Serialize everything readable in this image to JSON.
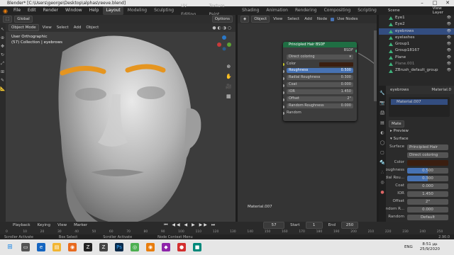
{
  "window": {
    "title": "Blender* [C:\\Users\\george\\Desktop\\alphas\\reeve.blend]"
  },
  "menu": {
    "items": [
      "File",
      "Edit",
      "Render",
      "Window",
      "Help"
    ],
    "workspaces": [
      "Layout",
      "Modeling",
      "Sculpting",
      "UV Editing",
      "Texture Paint",
      "Shading",
      "Animation",
      "Rendering",
      "Compositing",
      "Scripting"
    ],
    "active_workspace": "Layout",
    "scene": "Scene",
    "view_layer": "View Layer"
  },
  "viewport": {
    "mode": "Object Mode",
    "menus": [
      "View",
      "Select",
      "Add",
      "Object"
    ],
    "transform": "Global",
    "options": "Options",
    "overlay_title": "User Orthographic",
    "overlay_sub": "(57) Collection | eyebrows"
  },
  "node_editor": {
    "type": "Object",
    "menus": [
      "View",
      "Select",
      "Add",
      "Node"
    ],
    "use_nodes": "Use Nodes",
    "material_label": "Material.007",
    "node": {
      "title": "Principled Hair BSDF",
      "output": "BSDF",
      "dropdown": "Direct coloring",
      "rows": [
        {
          "label": "Color",
          "value": "",
          "type": "color"
        },
        {
          "label": "Roughness",
          "value": "0.500",
          "type": "blue"
        },
        {
          "label": "Radial Roughness",
          "value": "0.300",
          "type": "field"
        },
        {
          "label": "Coat",
          "value": "0.000",
          "type": "field"
        },
        {
          "label": "IOR",
          "value": "1.450",
          "type": "field"
        },
        {
          "label": "Offset",
          "value": "2°",
          "type": "field"
        },
        {
          "label": "Random Roughness",
          "value": "0.000",
          "type": "field"
        },
        {
          "label": "Random",
          "value": "",
          "type": "plain"
        }
      ]
    }
  },
  "outliner": {
    "items": [
      {
        "name": "Eye1",
        "selected": false
      },
      {
        "name": "Eye2",
        "selected": false
      },
      {
        "name": "eyebrows",
        "selected": true
      },
      {
        "name": "eyelashes",
        "selected": false
      },
      {
        "name": "Group1",
        "selected": false
      },
      {
        "name": "Group18167",
        "selected": false
      },
      {
        "name": "Plane",
        "selected": false
      },
      {
        "name": "Plane.001",
        "selected": false
      },
      {
        "name": "ZBrush_default_group",
        "selected": false
      }
    ]
  },
  "properties": {
    "object": "eyebrows",
    "material_tab": "Material.0",
    "slot": "Material.007",
    "mat_short": "Mate",
    "preview": "Preview",
    "surface": "Surface",
    "surface_value": "Principled Hair",
    "coloring": "Direct coloring",
    "rows": [
      {
        "label": "Color",
        "value": "",
        "type": "color"
      },
      {
        "label": "Roughness",
        "value": "0.500",
        "type": "blue"
      },
      {
        "label": "Radial Rou...",
        "value": "0.300",
        "type": "blue"
      },
      {
        "label": "Coat",
        "value": "0.000",
        "type": "field"
      },
      {
        "label": "IOR",
        "value": "1.450",
        "type": "field"
      },
      {
        "label": "Offset",
        "value": "2°",
        "type": "field"
      },
      {
        "label": "Random R...",
        "value": "0.000",
        "type": "field"
      },
      {
        "label": "Random",
        "value": "Default",
        "type": "field"
      }
    ]
  },
  "timeline": {
    "menus": [
      "Playback",
      "Keying",
      "View",
      "Marker"
    ],
    "current": "57",
    "start_label": "Start",
    "start": "1",
    "end_label": "End",
    "end": "250",
    "ticks": [
      "0",
      "10",
      "20",
      "30",
      "40",
      "50",
      "60",
      "70",
      "80",
      "90",
      "100",
      "110",
      "120",
      "130",
      "140",
      "150",
      "160",
      "170",
      "180",
      "190",
      "200",
      "210",
      "220",
      "230",
      "240",
      "250"
    ]
  },
  "status": {
    "items": [
      "Scroller Activate",
      "Box Select",
      "Scroller Activate",
      "Node Context Menu"
    ],
    "version": "2.90.0"
  },
  "taskbar": {
    "time": "8:51 μμ",
    "date": "25/9/2020",
    "lang": "ENG"
  },
  "colors": {
    "accent": "#4772b3",
    "node_header": "#1f6e43",
    "eyebrow": "#e0901e",
    "selection": "#334d80"
  }
}
